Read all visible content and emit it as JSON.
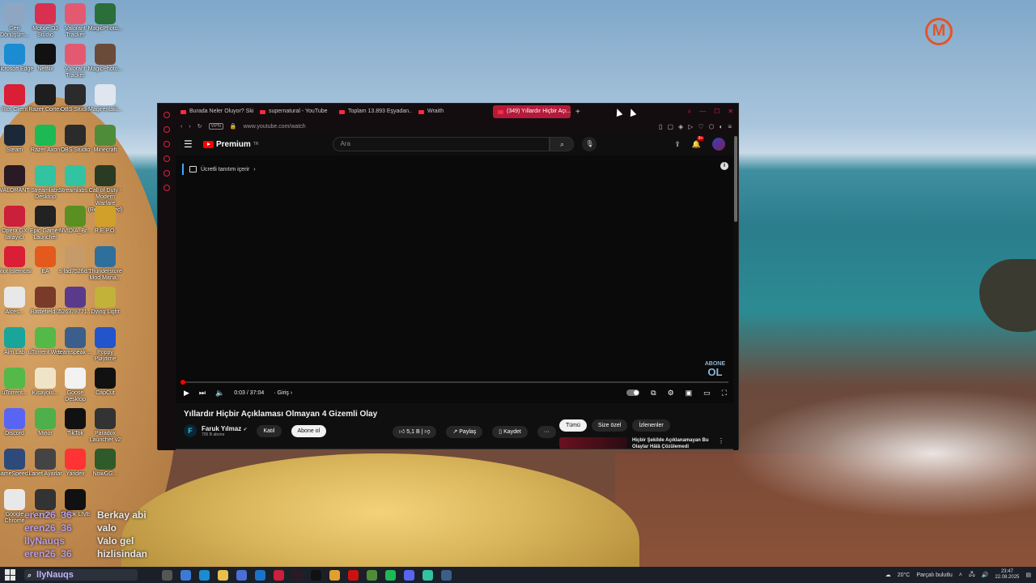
{
  "colors": {
    "accent": "#e0203f",
    "youtube_red": "#ff0000",
    "taskbar": "#1b2028"
  },
  "desktop_icons": [
    {
      "label": "Geri Dönüşüm...",
      "icon": "recycle-bin-icon",
      "color": "#8fa6c2"
    },
    {
      "label": "Mobile-DJ Studio",
      "icon": "app-icon",
      "color": "#d9304f"
    },
    {
      "label": "Valorant Tracker",
      "icon": "valorant-tracker-icon",
      "color": "#e35a70"
    },
    {
      "label": "MagicPhoto...",
      "icon": "app-icon",
      "color": "#2a6e3a"
    },
    {
      "label": "Microsoft Edge",
      "icon": "edge-icon",
      "color": "#1b8bd2"
    },
    {
      "label": "Netflix",
      "icon": "netflix-icon",
      "color": "#111"
    },
    {
      "label": "Valorant Tracker",
      "icon": "valorant-tracker-icon",
      "color": "#e35a70"
    },
    {
      "label": "MagicPhoto...",
      "icon": "game-icon",
      "color": "#6a4b3a"
    },
    {
      "label": "Riot Client",
      "icon": "riot-icon",
      "color": "#d91e36"
    },
    {
      "label": "Razer Cortex",
      "icon": "razer-icon",
      "color": "#1e1e1e"
    },
    {
      "label": "OBS Studio",
      "icon": "obs-icon",
      "color": "#2b2b2b"
    },
    {
      "label": "Magirentaki...",
      "icon": "app-icon",
      "color": "#dfe6ef"
    },
    {
      "label": "Steam",
      "icon": "steam-icon",
      "color": "#1b2838"
    },
    {
      "label": "Razer Axon",
      "icon": "razer-axon-icon",
      "color": "#1db954"
    },
    {
      "label": "OBS Studio",
      "icon": "obs-icon",
      "color": "#2b2b2b"
    },
    {
      "label": "Minecraft",
      "icon": "minecraft-icon",
      "color": "#4e8c3a"
    },
    {
      "label": "VALORANT",
      "icon": "valorant-icon",
      "color": "#2a1a25"
    },
    {
      "label": "Streamlabs Desktop",
      "icon": "streamlabs-icon",
      "color": "#31c3a2"
    },
    {
      "label": "Streamlabs...",
      "icon": "streamlabs-icon",
      "color": "#31c3a2"
    },
    {
      "label": "Call of Duty - Modern Warfare (Remastered)",
      "icon": "cod-icon",
      "color": "#2b3b23"
    },
    {
      "label": "Opera GX tarayıcı",
      "icon": "opera-gx-icon",
      "color": "#cc1f3b"
    },
    {
      "label": "Epic Games Launcher",
      "icon": "epic-icon",
      "color": "#222"
    },
    {
      "label": "NVIDIA_Br...",
      "icon": "nvidia-icon",
      "color": "#5a8f21"
    },
    {
      "label": "R.E.P.O.",
      "icon": "game-icon",
      "color": "#d1a02a"
    },
    {
      "label": "Riot İstemcisi",
      "icon": "riot-icon",
      "color": "#d91e36"
    },
    {
      "label": "EA",
      "icon": "ea-icon",
      "color": "#e35a1c"
    },
    {
      "label": "s-fad7526d...",
      "icon": "image-icon",
      "color": "#c79a6a"
    },
    {
      "label": "Thunderstore Mod Mana...",
      "icon": "thunderstore-icon",
      "color": "#2f6f9c"
    },
    {
      "label": "Alces...",
      "icon": "file-icon",
      "color": "#e8e8e8"
    },
    {
      "label": "Battlefield 1",
      "icon": "battlefield-icon",
      "color": "#7a3a2a"
    },
    {
      "label": "526378771...",
      "icon": "app-icon",
      "color": "#5a3a8a"
    },
    {
      "label": "Dying Light",
      "icon": "dying-light-icon",
      "color": "#c2b23a"
    },
    {
      "label": "Aim Lab",
      "icon": "aimlab-icon",
      "color": "#19a59a"
    },
    {
      "label": "uTorrent Web",
      "icon": "utorrent-icon",
      "color": "#54b948"
    },
    {
      "label": "teamspeak-...",
      "icon": "teamspeak-icon",
      "color": "#3b5f8a"
    },
    {
      "label": "Poppy Playtime",
      "icon": "poppy-icon",
      "color": "#2255cc"
    },
    {
      "label": "uTorrent...",
      "icon": "utorrent-icon",
      "color": "#54b948"
    },
    {
      "label": "Kısayolu...",
      "icon": "file-icon",
      "color": "#f0e4c8"
    },
    {
      "label": "Goose Desktop",
      "icon": "goose-icon",
      "color": "#f2f2f2"
    },
    {
      "label": "CapCut",
      "icon": "capcut-icon",
      "color": "#111"
    },
    {
      "label": "Discord",
      "icon": "discord-icon",
      "color": "#5865f2"
    },
    {
      "label": "Minor",
      "icon": "app-icon",
      "color": "#4db04a"
    },
    {
      "label": "TikTok",
      "icon": "tiktok-icon",
      "color": "#111"
    },
    {
      "label": "Paradox Launcher v2",
      "icon": "paradox-icon",
      "color": "#333"
    },
    {
      "label": "GameSpeed...",
      "icon": "app-icon",
      "color": "#2e4a7a"
    },
    {
      "label": "Lanet Ayarlar",
      "icon": "settings-icon",
      "color": "#444"
    },
    {
      "label": "Yandex",
      "icon": "yandex-icon",
      "color": "#f33"
    },
    {
      "label": "NowGG...",
      "icon": "app-icon",
      "color": "#2f5a2a"
    },
    {
      "label": "Google Chrome",
      "icon": "chrome-icon",
      "color": "#e8e8e8"
    },
    {
      "label": "Liquidity...",
      "icon": "app-icon",
      "color": "#333"
    },
    {
      "label": "TikTok LIVE",
      "icon": "tiktok-icon",
      "color": "#111"
    }
  ],
  "chat": [
    {
      "user": "eren26_36",
      "message": "Berkay abi"
    },
    {
      "user": "eren26_36",
      "message": "valo"
    },
    {
      "user": "llyNauqs",
      "message": "Valo gel"
    },
    {
      "user": "eren26_36",
      "message": "hizlisindan"
    }
  ],
  "browser": {
    "tabs": [
      {
        "label": "Burada Neler Oluyor? Ski...",
        "active": false
      },
      {
        "label": "supernatural - YouTube",
        "active": false
      },
      {
        "label": "Toplam 13.893 Eşyadan...",
        "active": false
      },
      {
        "label": "Wraith",
        "active": false
      },
      {
        "label": "(349) Yıllardır Hiçbir Açı...",
        "active": true
      }
    ],
    "new_tab": "+",
    "vpn": "VPN",
    "url": "www.youtube.com/watch"
  },
  "youtube": {
    "brand": "Premium",
    "country": "TR",
    "search_placeholder": "Ara",
    "notification_count": "9+",
    "promo": "Ücretli tanıtım içerir",
    "watermark_top": "ABONE",
    "watermark_bottom": "OL",
    "player": {
      "time": "0:03 / 37:04",
      "chapter": "Giriş",
      "progress_fraction": 0.001
    },
    "video_title": "Yıllardır Hiçbir Açıklaması Olmayan 4 Gizemli Olay",
    "channel": {
      "initial": "F",
      "name": "Faruk Yılmaz",
      "subscribers": "705 B abone",
      "join": "Katıl",
      "subscribe": "Abone ol"
    },
    "actions": {
      "likes": "5,1 B",
      "share": "Paylaş",
      "save": "Kaydet"
    },
    "chips": [
      "Tümü",
      "Size özel",
      "İzlenenler"
    ],
    "related_title": "Hiçbir Şekilde Açıklanamayan Bu Olaylar Hâlâ Çözülemedi"
  },
  "taskbar": {
    "search_text": "llyNauqs",
    "weather": "20°C",
    "weather_desc": "Parçalı bulutlu",
    "time": "23:47",
    "date": "22.08.2025"
  }
}
